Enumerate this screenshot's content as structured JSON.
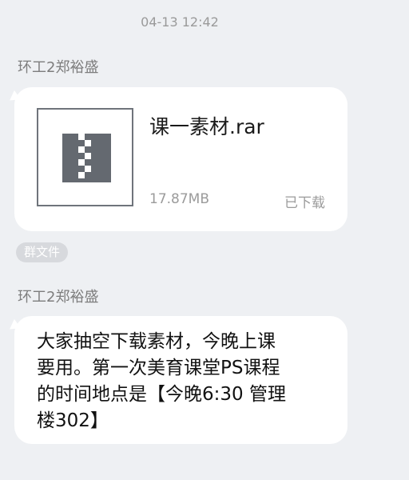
{
  "chat": {
    "timestamp": "04-13 12:42",
    "messages": [
      {
        "sender": "环工2郑裕盛",
        "type": "file",
        "file": {
          "name": "课一素材.rar",
          "size": "17.87MB",
          "status": "已下载",
          "icon": "zip-archive-icon"
        },
        "tag": "群文件"
      },
      {
        "sender": "环工2郑裕盛",
        "type": "text",
        "text": "大家抽空下载素材，今晚上课\n要用。第一次美育课堂PS课程\n的时间地点是【今晚6:30 管理\n楼302】"
      }
    ]
  },
  "colors": {
    "background": "#eef0f3",
    "bubble": "#ffffff",
    "icon_gray": "#646970",
    "muted_text": "#9b9b9b"
  }
}
